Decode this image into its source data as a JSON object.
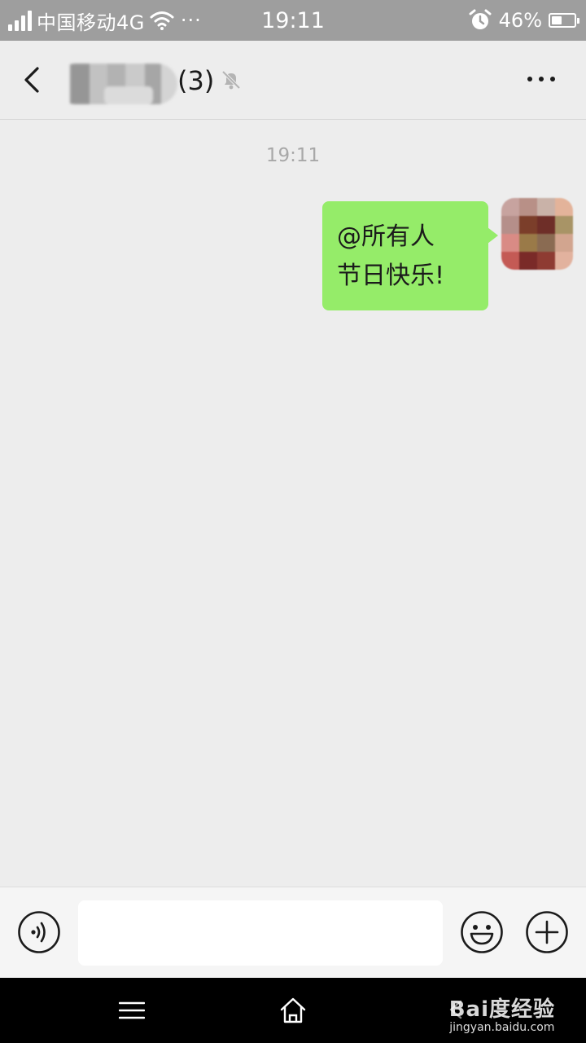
{
  "status_bar": {
    "carrier": "中国移动4G",
    "more": "···",
    "time": "19:11",
    "battery_percent": "46%",
    "battery_level": 0.46
  },
  "header": {
    "member_count": "(3)",
    "back_icon": "chevron-left-icon",
    "mute_icon": "bell-muted-icon",
    "more_icon": "more-dots-icon"
  },
  "conversation": {
    "timestamp": "19:11",
    "messages": [
      {
        "from": "self",
        "lines": [
          "@所有人",
          "节日快乐!"
        ]
      }
    ]
  },
  "input_bar": {
    "value": "",
    "placeholder": "",
    "voice_icon": "voice-input-icon",
    "emoji_icon": "emoji-icon",
    "plus_icon": "plus-circle-icon"
  },
  "system_nav": {
    "menu_icon": "menu-icon",
    "home_icon": "home-icon",
    "back_icon": "back-icon"
  },
  "watermark": {
    "logo": "Bai度经验",
    "url": "jingyan.baidu.com"
  },
  "colors": {
    "bubble_self": "#95ec69",
    "background": "#ededed",
    "status_bar": "#9e9e9e"
  }
}
